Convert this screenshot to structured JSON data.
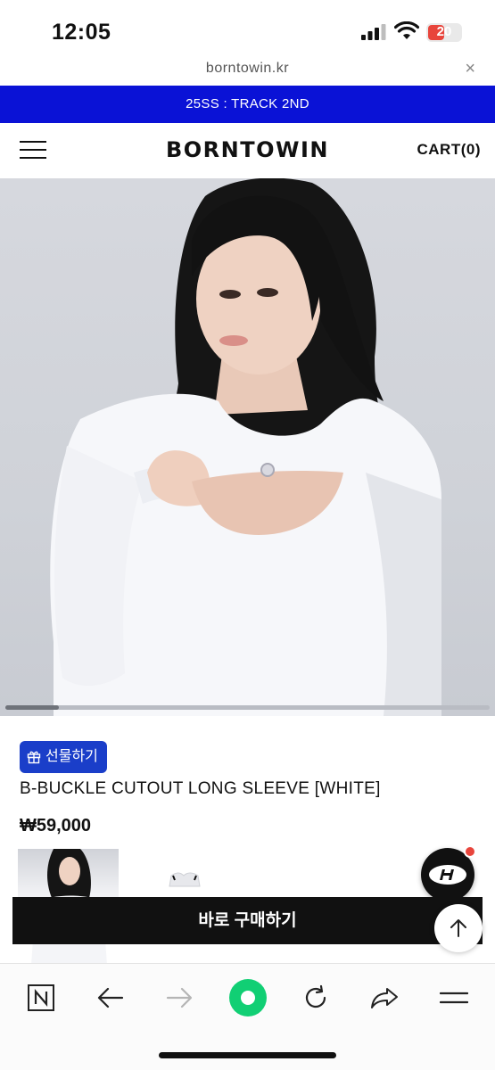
{
  "status_bar": {
    "time": "12:05",
    "battery": "20"
  },
  "browser": {
    "url": "borntowin.kr",
    "close_label": "×"
  },
  "announcement": {
    "text": "25SS : TRACK 2ND"
  },
  "header": {
    "logo": "BORNTOWIN",
    "cart": "CART(0)"
  },
  "product": {
    "gift_label": "선물하기",
    "title": "B-BUCKLE CUTOUT LONG SLEEVE [WHITE]",
    "price": "₩59,000",
    "image_scroll_position": 0.08
  },
  "actions": {
    "buy_now": "바로 구매하기"
  },
  "colors": {
    "announcement_bg": "#0a12d6",
    "gift_bg": "#1a3ec9",
    "buy_bg": "#111111",
    "browser_green": "#11cf74",
    "badge_red": "#e8453c"
  },
  "toolbar_icons": [
    "naver-n-icon",
    "back-arrow-icon",
    "forward-arrow-icon",
    "green-dot-icon",
    "refresh-icon",
    "share-icon",
    "menu-icon"
  ]
}
